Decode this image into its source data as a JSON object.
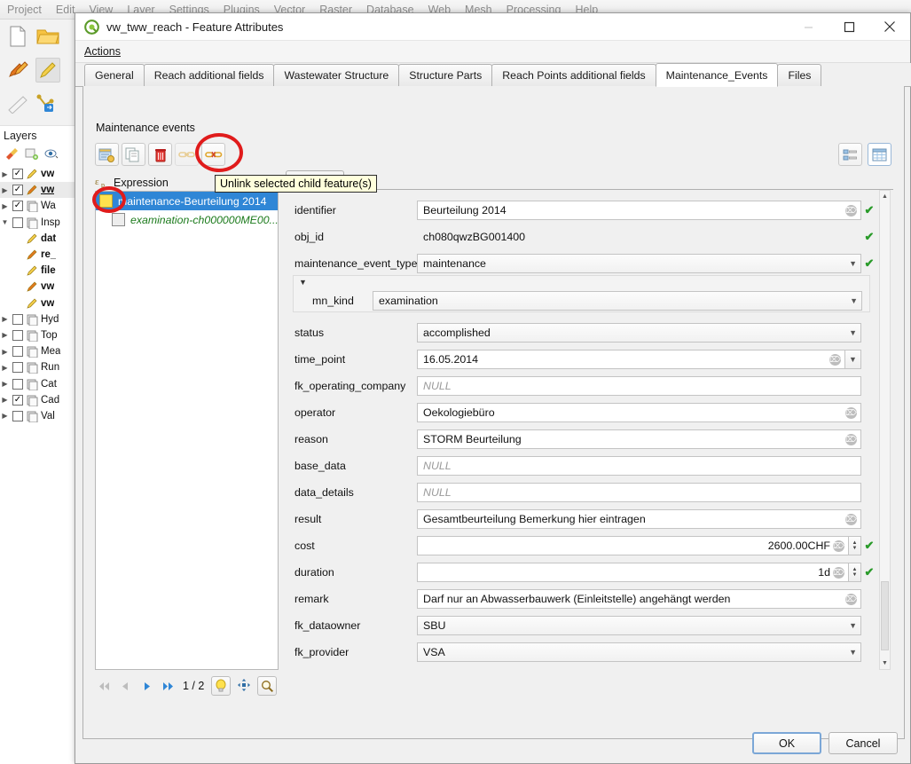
{
  "app": {
    "menus": [
      "Project",
      "Edit",
      "View",
      "Layer",
      "Settings",
      "Plugins",
      "Vector",
      "Raster",
      "Database",
      "Web",
      "Mesh",
      "Processing",
      "Help"
    ],
    "layers_panel_title": "Layers",
    "layer_items": [
      {
        "label": "vw",
        "checked": true,
        "expandable": true,
        "style": "bold"
      },
      {
        "label": "vw",
        "checked": true,
        "expandable": true,
        "style": "underline"
      },
      {
        "label": "Wa",
        "checked": true,
        "expandable": true,
        "style": "normal"
      },
      {
        "label": "Insp",
        "checked": false,
        "expandable": true,
        "style": "normal"
      },
      {
        "label": "dat",
        "checked": null,
        "expandable": false,
        "style": "bold"
      },
      {
        "label": "re_",
        "checked": null,
        "expandable": false,
        "style": "bold"
      },
      {
        "label": "file",
        "checked": null,
        "expandable": false,
        "style": "bold"
      },
      {
        "label": "vw",
        "checked": null,
        "expandable": false,
        "style": "bold"
      },
      {
        "label": "vw",
        "checked": null,
        "expandable": false,
        "style": "bold"
      },
      {
        "label": "Hyd",
        "checked": false,
        "expandable": true,
        "style": "normal"
      },
      {
        "label": "Top",
        "checked": false,
        "expandable": true,
        "style": "normal"
      },
      {
        "label": "Mea",
        "checked": false,
        "expandable": true,
        "style": "normal"
      },
      {
        "label": "Run",
        "checked": false,
        "expandable": true,
        "style": "normal"
      },
      {
        "label": "Cat",
        "checked": false,
        "expandable": true,
        "style": "normal"
      },
      {
        "label": "Cad",
        "checked": true,
        "expandable": true,
        "style": "normal"
      },
      {
        "label": "Val",
        "checked": false,
        "expandable": true,
        "style": "normal"
      }
    ]
  },
  "dialog": {
    "title": "vw_tww_reach - Feature Attributes",
    "icon": "qgis-logo-icon",
    "window_buttons": [
      "minimize-button",
      "maximize-button",
      "close-button"
    ],
    "menu": "Actions",
    "tabs": [
      {
        "label": "General",
        "active": false
      },
      {
        "label": "Reach additional fields",
        "active": false
      },
      {
        "label": "Wastewater Structure",
        "active": false
      },
      {
        "label": "Structure Parts",
        "active": false
      },
      {
        "label": "Reach Points additional fields",
        "active": false
      },
      {
        "label": "Maintenance_Events",
        "active": true
      },
      {
        "label": "Files",
        "active": false
      }
    ],
    "section_title": "Maintenance events",
    "toolbar": [
      {
        "name": "add-child-feature-button",
        "icon": "add-feature-icon",
        "disabled": false
      },
      {
        "name": "duplicate-child-feature-button",
        "icon": "duplicate-feature-icon",
        "disabled": false
      },
      {
        "name": "delete-child-feature-button",
        "icon": "trash-icon",
        "disabled": false
      },
      {
        "name": "link-child-feature-button",
        "icon": "link-icon",
        "disabled": true
      },
      {
        "name": "unlink-child-feature-button",
        "icon": "unlink-icon",
        "disabled": false
      }
    ],
    "tooltip": "Unlink selected child feature(s)",
    "view_buttons": [
      {
        "name": "form-view-button",
        "icon": "form-view-icon",
        "active": false
      },
      {
        "name": "table-view-button",
        "icon": "table-view-icon",
        "active": true
      }
    ],
    "expression_label": "Expression",
    "expression_icon": "expression-epsilon-icon",
    "child_list": [
      {
        "label": "maintenance-Beurteilung 2014",
        "selected": true,
        "checkbox": "checked",
        "child": false
      },
      {
        "label": "examination-ch000000ME00...",
        "selected": false,
        "checkbox": "unchecked",
        "child": true
      }
    ],
    "navigation": {
      "first_label": "first-feature",
      "prev_label": "previous-feature",
      "next_label": "next-feature",
      "last_label": "last-feature",
      "counter": "1 / 2",
      "extra_buttons": [
        "highlight-feature-button",
        "pan-to-feature-button",
        "zoom-to-feature-button"
      ]
    },
    "inner_tab": "General",
    "form_fields": [
      {
        "label": "identifier",
        "value": "Beurteilung 2014",
        "type": "text",
        "clear": true,
        "valid": true,
        "null": false
      },
      {
        "label": "obj_id",
        "value": "ch080qwzBG001400",
        "type": "text-flat",
        "clear": false,
        "valid": true,
        "null": false
      },
      {
        "label": "maintenance_event_type",
        "value": "maintenance",
        "type": "combo",
        "clear": false,
        "valid": true,
        "null": false
      },
      {
        "label": "mn_kind",
        "value": "examination",
        "type": "combo-group",
        "clear": false,
        "valid": false,
        "null": false
      },
      {
        "label": "status",
        "value": "accomplished",
        "type": "combo",
        "clear": false,
        "valid": false,
        "null": false
      },
      {
        "label": "time_point",
        "value": "16.05.2014",
        "type": "date",
        "clear": true,
        "valid": false,
        "null": false
      },
      {
        "label": "fk_operating_company",
        "value": "NULL",
        "type": "text",
        "clear": false,
        "valid": false,
        "null": true
      },
      {
        "label": "operator",
        "value": "Oekologiebüro",
        "type": "text",
        "clear": true,
        "valid": false,
        "null": false
      },
      {
        "label": "reason",
        "value": "STORM Beurteilung",
        "type": "text",
        "clear": true,
        "valid": false,
        "null": false
      },
      {
        "label": "base_data",
        "value": "NULL",
        "type": "text",
        "clear": false,
        "valid": false,
        "null": true
      },
      {
        "label": "data_details",
        "value": "NULL",
        "type": "text",
        "clear": false,
        "valid": false,
        "null": true
      },
      {
        "label": "result",
        "value": "Gesamtbeurteilung Bemerkung hier eintragen",
        "type": "text",
        "clear": true,
        "valid": false,
        "null": false
      },
      {
        "label": "cost",
        "value": "2600.00CHF",
        "type": "spin",
        "clear": true,
        "valid": true,
        "null": false
      },
      {
        "label": "duration",
        "value": "1d",
        "type": "spin",
        "clear": true,
        "valid": true,
        "null": false
      },
      {
        "label": "remark",
        "value": "Darf nur an Abwasserbauwerk (Einleitstelle) angehängt werden",
        "type": "text",
        "clear": true,
        "valid": false,
        "null": false
      },
      {
        "label": "fk_dataowner",
        "value": "SBU",
        "type": "combo",
        "clear": false,
        "valid": false,
        "null": false
      },
      {
        "label": "fk_provider",
        "value": "VSA",
        "type": "combo",
        "clear": false,
        "valid": false,
        "null": false
      }
    ],
    "ok_label": "OK",
    "cancel_label": "Cancel"
  },
  "colors": {
    "annotation_red": "#e01b1b",
    "selection_blue": "#2f86d6",
    "valid_green": "#2a9b2a",
    "checkbox_yellow": "#ffe14d",
    "child_green": "#1b7a1b"
  }
}
